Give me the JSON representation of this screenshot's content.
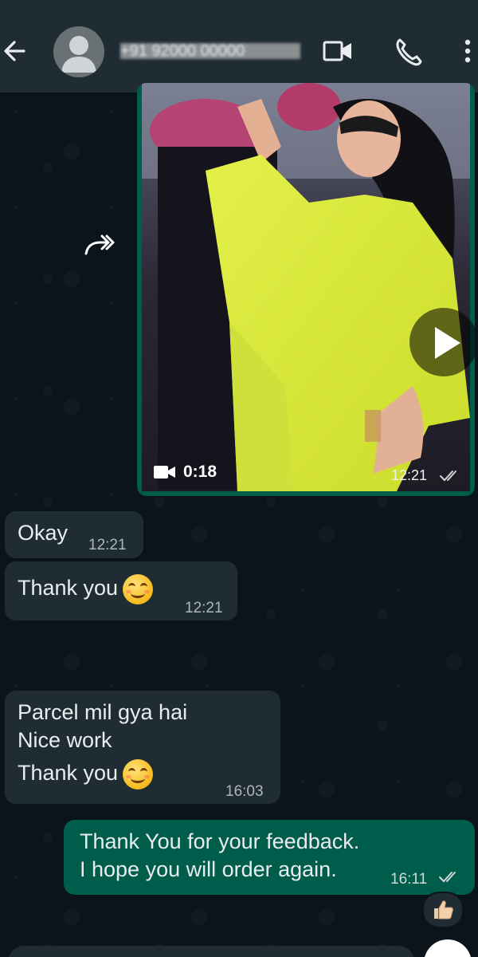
{
  "header": {
    "contact_name": "+91 92000 00000",
    "icons": [
      "back-arrow-icon",
      "avatar-icon",
      "video-call-icon",
      "phone-icon",
      "more-vert-icon"
    ]
  },
  "media_message": {
    "duration": "0:18",
    "time": "12:21",
    "status": "read"
  },
  "messages_in": [
    {
      "text": "Okay",
      "time": "12:21"
    },
    {
      "text": "Thank you",
      "time": "12:21"
    },
    {
      "lines": [
        "Parcel mil gya hai",
        "Nice work",
        "Thank you"
      ],
      "time": "16:03"
    }
  ],
  "message_out": {
    "lines": [
      "Thank You for your feedback.",
      "I hope you will order again."
    ],
    "time": "16:11",
    "status": "read"
  },
  "reaction": "👍🏻",
  "colors": {
    "background": "#0b141a",
    "header": "#1f2c34",
    "incoming_bubble": "#1f2c34",
    "outgoing_bubble": "#005c4b",
    "read_ticks": "#aeb7bb"
  }
}
